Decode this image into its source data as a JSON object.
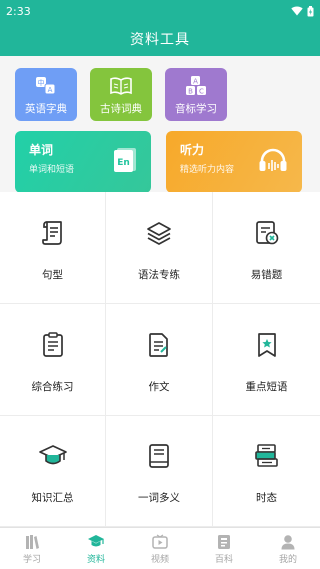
{
  "status": {
    "time": "2:33"
  },
  "header": {
    "title": "资料工具"
  },
  "shortcuts": [
    {
      "label": "英语字典",
      "icon": "translate-icon",
      "color": "#6f9ef5"
    },
    {
      "label": "古诗词典",
      "icon": "book-open-icon",
      "color": "#84c53d"
    },
    {
      "label": "音标学习",
      "icon": "abc-blocks-icon",
      "color": "#9f79cf"
    }
  ],
  "feature_cards": [
    {
      "title": "单词",
      "subtitle": "单词和短语",
      "icon": "en-book-icon"
    },
    {
      "title": "听力",
      "subtitle": "精选听力内容",
      "icon": "headphones-icon"
    }
  ],
  "grid": [
    {
      "label": "句型",
      "icon": "scroll-icon"
    },
    {
      "label": "语法专练",
      "icon": "layers-icon"
    },
    {
      "label": "易错题",
      "icon": "error-doc-icon"
    },
    {
      "label": "综合练习",
      "icon": "clipboard-icon"
    },
    {
      "label": "作文",
      "icon": "document-icon"
    },
    {
      "label": "重点短语",
      "icon": "bookmark-star-icon"
    },
    {
      "label": "知识汇总",
      "icon": "graduation-cap-icon"
    },
    {
      "label": "一词多义",
      "icon": "book-icon"
    },
    {
      "label": "时态",
      "icon": "book-stack-icon"
    }
  ],
  "bottom_nav": [
    {
      "label": "学习",
      "icon": "books-icon",
      "active": false
    },
    {
      "label": "资料",
      "icon": "graduation-cap-icon",
      "active": true
    },
    {
      "label": "视频",
      "icon": "video-icon",
      "active": false
    },
    {
      "label": "百科",
      "icon": "encyclopedia-icon",
      "active": false
    },
    {
      "label": "我的",
      "icon": "person-icon",
      "active": false
    }
  ],
  "colors": {
    "primary": "#21b69a",
    "inactive": "#a5a5a5"
  }
}
